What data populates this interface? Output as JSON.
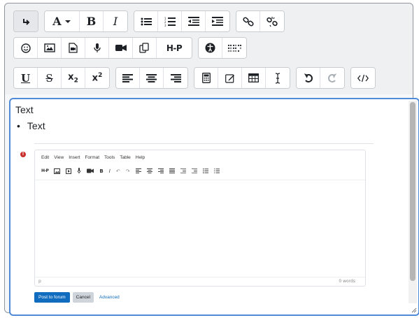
{
  "toolbar": {
    "row1": {
      "groups": [
        [
          "arrow-down-right-icon"
        ],
        [
          "font-color-icon",
          "bold",
          "italic"
        ],
        [
          "unordered-list-icon",
          "ordered-list-icon",
          "outdent-icon",
          "indent-icon"
        ],
        [
          "link-icon",
          "unlink-icon"
        ]
      ],
      "bold_label": "B",
      "italic_label": "I"
    },
    "row2": {
      "h5p_label": "H-P"
    },
    "row3": {
      "underline_label": "U",
      "strike_label": "S",
      "subscript_label": "x",
      "subscript_sub": "2",
      "superscript_label": "x",
      "superscript_sup": "2"
    }
  },
  "content": {
    "paragraph": "Text",
    "list_item": "Text"
  },
  "embedded": {
    "menu": [
      "Edit",
      "View",
      "Insert",
      "Format",
      "Tools",
      "Table",
      "Help"
    ],
    "status_left": "p",
    "status_right": "0 words",
    "post_button": "Post to forum",
    "cancel_button": "Cancel",
    "advanced_link": "Advanced"
  },
  "colors": {
    "accent": "#4f8bd6",
    "primary_button": "#0f6cbf",
    "error": "#c9302c"
  }
}
